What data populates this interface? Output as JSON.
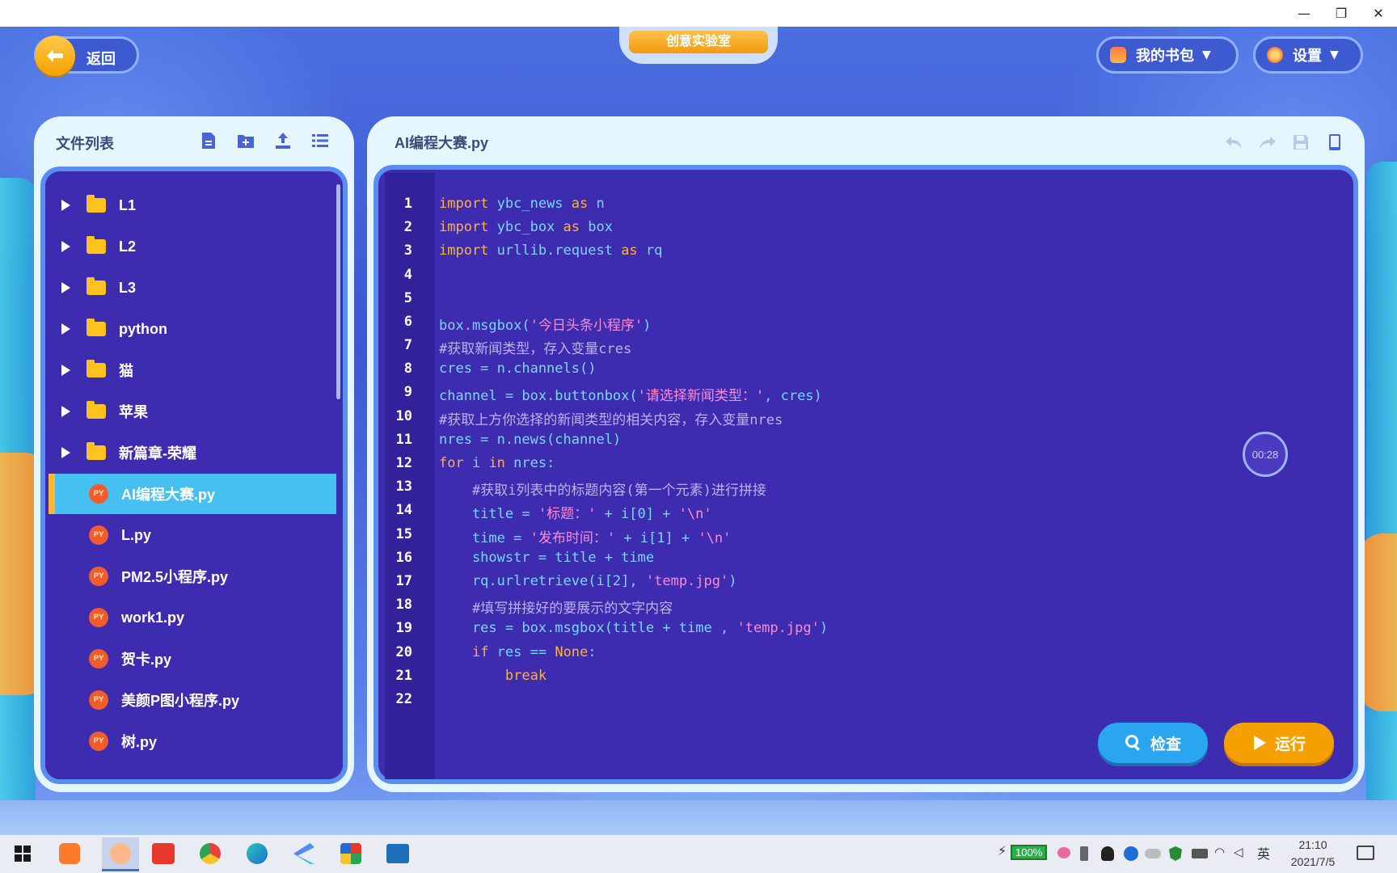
{
  "window": {
    "controls": [
      "—",
      "❐",
      "✕"
    ]
  },
  "header": {
    "back_label": "返回",
    "center_tab": "创意实验室",
    "bag_label": "我的书包",
    "settings_label": "设置"
  },
  "file_panel": {
    "title": "文件列表",
    "folders": [
      "L1",
      "L2",
      "L3",
      "python",
      "猫",
      "苹果",
      "新篇章-荣耀"
    ],
    "files": [
      "AI编程大赛.py",
      "L.py",
      "PM2.5小程序.py",
      "work1.py",
      "贺卡.py",
      "美颜P图小程序.py",
      "树.py"
    ],
    "selected_file": "AI编程大赛.py",
    "py_badge": "PY"
  },
  "editor": {
    "filename": "AI编程大赛.py",
    "line_numbers": [
      "1",
      "2",
      "3",
      "4",
      "5",
      "6",
      "7",
      "8",
      "9",
      "10",
      "11",
      "12",
      "13",
      "14",
      "15",
      "16",
      "17",
      "18",
      "19",
      "20",
      "21",
      "22"
    ],
    "timer": "00:28",
    "check_label": "检查",
    "run_label": "运行"
  },
  "colors": {
    "editor_bg": "#3d2bb0",
    "keyword": "#ffb13d",
    "string": "#ff8ad6",
    "comment": "#bcb3ec",
    "identifier": "#7ad7ff",
    "accent_orange": "#f5a000",
    "accent_blue": "#2aa6f0"
  },
  "taskbar": {
    "battery": "100%",
    "ime": "英",
    "time": "21:10",
    "date": "2021/7/5"
  }
}
